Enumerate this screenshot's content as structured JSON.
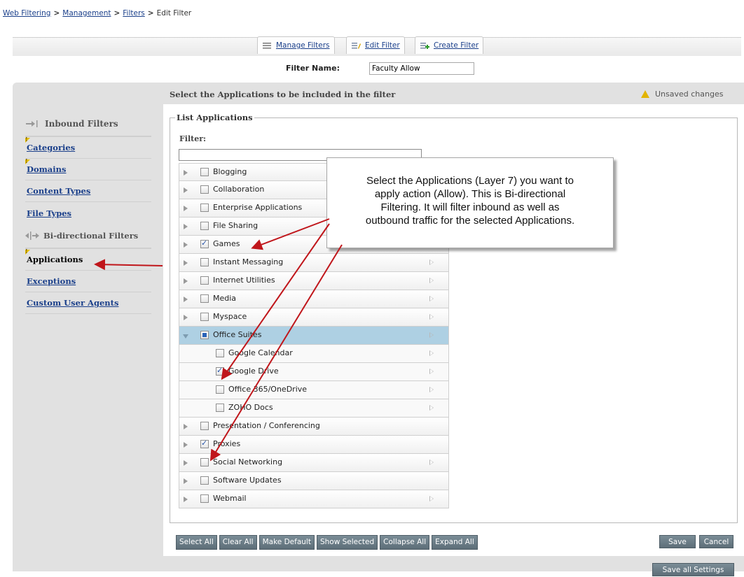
{
  "breadcrumb": {
    "items": [
      "Web Filtering",
      "Management",
      "Filters"
    ],
    "current": "Edit Filter",
    "separator": ">"
  },
  "tabs": [
    {
      "label": "Manage Filters",
      "icon": "list-icon"
    },
    {
      "label": "Edit Filter",
      "icon": "edit-filter-icon"
    },
    {
      "label": "Create Filter",
      "icon": "create-filter-icon"
    }
  ],
  "filter_name": {
    "label": "Filter Name:",
    "value": "Faculty Allow"
  },
  "panel": {
    "title": "Select the Applications to be included in the filter",
    "unsaved": "Unsaved changes"
  },
  "sidebar": {
    "inbound_heading": "Inbound Filters",
    "inbound_items": [
      {
        "label": "Categories",
        "flag": true
      },
      {
        "label": "Domains",
        "flag": true
      },
      {
        "label": "Content Types",
        "flag": false
      },
      {
        "label": "File Types",
        "flag": false
      }
    ],
    "bidirectional_heading": "Bi-directional Filters",
    "bidirectional_items": [
      {
        "label": "Applications",
        "flag": true,
        "active": true
      },
      {
        "label": "Exceptions",
        "flag": false
      },
      {
        "label": "Custom User Agents",
        "flag": false
      }
    ]
  },
  "list": {
    "legend": "List Applications",
    "filter_label": "Filter:",
    "filter_value": "",
    "rows": [
      {
        "label": "Blogging",
        "checked": false
      },
      {
        "label": "Collaboration",
        "checked": false
      },
      {
        "label": "Enterprise Applications",
        "checked": false
      },
      {
        "label": "File Sharing",
        "checked": false
      },
      {
        "label": "Games",
        "checked": true
      },
      {
        "label": "Instant Messaging",
        "checked": false
      },
      {
        "label": "Internet Utilities",
        "checked": false
      },
      {
        "label": "Media",
        "checked": false
      },
      {
        "label": "Myspace",
        "checked": false
      },
      {
        "label": "Office Suites",
        "checked": "partial",
        "expanded": true
      },
      {
        "label": "Google Calendar",
        "checked": false,
        "child": true
      },
      {
        "label": "Google Drive",
        "checked": true,
        "child": true
      },
      {
        "label": "Office 365/OneDrive",
        "checked": false,
        "child": true
      },
      {
        "label": "ZOHO Docs",
        "checked": false,
        "child": true
      },
      {
        "label": "Presentation / Conferencing",
        "checked": false
      },
      {
        "label": "Proxies",
        "checked": true
      },
      {
        "label": "Social Networking",
        "checked": false
      },
      {
        "label": "Software Updates",
        "checked": false
      },
      {
        "label": "Webmail",
        "checked": false
      }
    ]
  },
  "buttons": {
    "select_all": "Select All",
    "clear_all": "Clear All",
    "make_default": "Make Default",
    "show_selected": "Show Selected",
    "collapse_all": "Collapse All",
    "expand_all": "Expand All",
    "save": "Save",
    "cancel": "Cancel",
    "save_all": "Save all Settings"
  },
  "callout": {
    "lines": [
      "Select the Applications (Layer 7) you want to",
      "apply action (Allow).  This is Bi-directional",
      "Filtering.  It will filter inbound as well as",
      "outbound traffic for the selected Applications."
    ]
  },
  "colors": {
    "link": "#1a3f8a",
    "selected_row": "#aed0e3",
    "button": "#6b7c86",
    "arrow": "#c0161b"
  }
}
